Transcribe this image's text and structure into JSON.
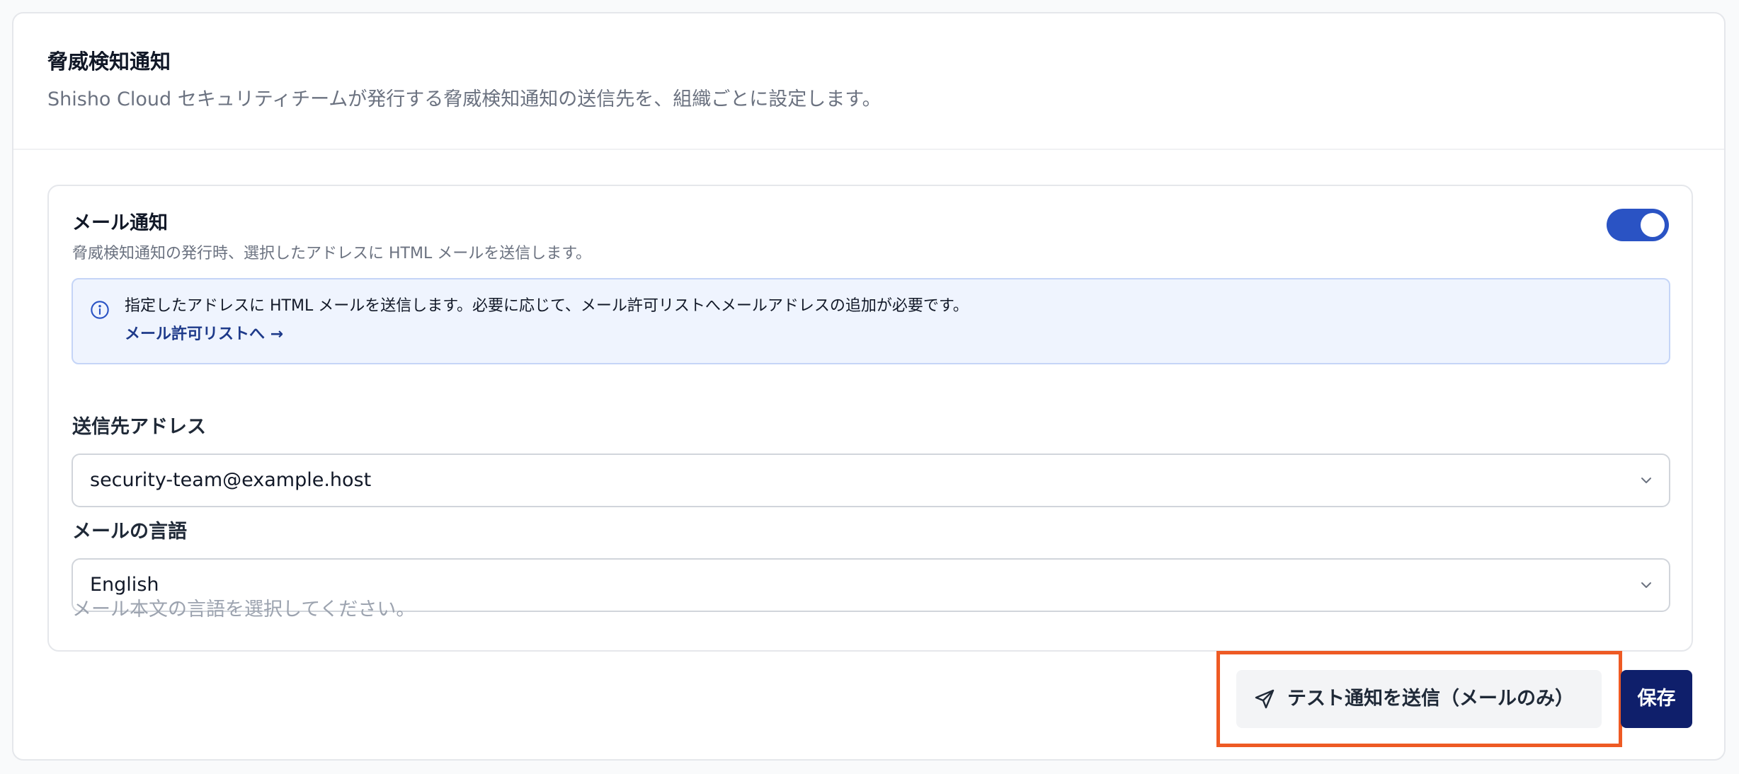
{
  "section": {
    "title": "脅威検知通知",
    "description": "Shisho Cloud セキュリティチームが発行する脅威検知通知の送信先を、組織ごとに設定します。"
  },
  "email_card": {
    "title": "メール通知",
    "description": "脅威検知通知の発行時、選択したアドレスに HTML メールを送信します。",
    "enabled": true,
    "info_text": "指定したアドレスに HTML メールを送信します。必要に応じて、メール許可リストへメールアドレスの追加が必要です。",
    "info_link": "メール許可リストへ →",
    "address_label": "送信先アドレス",
    "address_value": "security-team@example.host",
    "language_label": "メールの言語",
    "language_value": "English",
    "language_hint": "メール本文の言語を選択してください。"
  },
  "actions": {
    "test_label": "テスト通知を送信（メールのみ）",
    "save_label": "保存"
  },
  "colors": {
    "accent": "#2a53c4",
    "primary_button": "#0f1f6b",
    "highlight": "#ee5a24",
    "info_bg": "#eff4fe"
  }
}
